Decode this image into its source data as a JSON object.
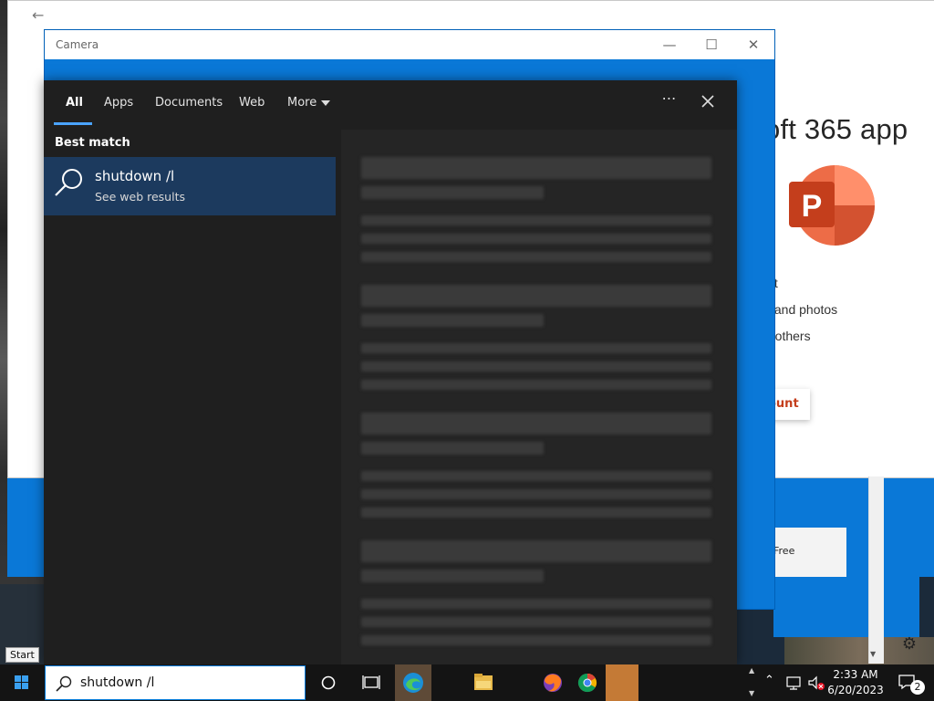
{
  "office": {
    "heading": "oft 365 app",
    "lines": [
      "int",
      "s and photos",
      "h others"
    ],
    "button_label": "ount",
    "lower_card_text": "Free"
  },
  "camera": {
    "title": "Camera"
  },
  "search": {
    "tabs": [
      {
        "label": "All",
        "active": true
      },
      {
        "label": "Apps"
      },
      {
        "label": "Documents"
      },
      {
        "label": "Web"
      },
      {
        "label": "More"
      }
    ],
    "best_match_label": "Best match",
    "result_title": "shutdown /l",
    "result_subtitle": "See web results",
    "query": "shutdown /l"
  },
  "taskbar": {
    "start_tooltip": "Start",
    "time": "2:33 AM",
    "date": "6/20/2023",
    "notification_count": "2",
    "apps": [
      "edge-icon",
      "file-explorer-icon",
      "firefox-icon",
      "chrome-icon"
    ]
  },
  "colors": {
    "accent": "#0a78d7",
    "search_panel": "#1f1f1f",
    "selected_result": "#1c3a5e",
    "powerpoint": "#c43e1c"
  }
}
